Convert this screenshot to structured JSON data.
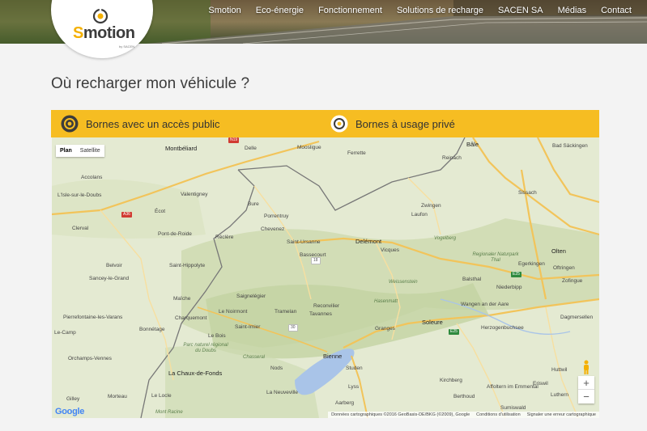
{
  "nav": [
    "Smotion",
    "Eco-énergie",
    "Fonctionnement",
    "Solutions de recharge",
    "SACEN SA",
    "Médias",
    "Contact"
  ],
  "logo": {
    "s": "S",
    "rest": "motion",
    "by": "by SACEN"
  },
  "page_title": "Où recharger mon véhicule ?",
  "tabs": {
    "public": "Bornes avec un accès public",
    "private": "Bornes à usage privé"
  },
  "map": {
    "type_plan": "Plan",
    "type_satellite": "Satellite",
    "zoom_in": "+",
    "zoom_out": "−",
    "google": "Google",
    "attribution": [
      "Données cartographiques ©2016 GeoBasis-DE/BKG (©2009), Google",
      "Conditions d'utilisation",
      "Signaler une erreur cartographique"
    ],
    "towns": [
      "Bâle",
      "Bad Säckingen",
      "Montbéliard",
      "Delle",
      "Moosligue",
      "Ferrette",
      "Reinach",
      "Accolans",
      "L'Isle-sur-le-Doubs",
      "Valentigney",
      "Sissach",
      "Écot",
      "Bure",
      "Porrentruy",
      "Zwingen",
      "Laufon",
      "Clerval",
      "Chevenez",
      "Pont-de-Roide",
      "Réclère",
      "Saint-Ursanne",
      "Delémont",
      "Vicques",
      "Olten",
      "Belvoir",
      "Saint-Hippolyte",
      "Bassecourt",
      "Egerkingen",
      "Oftringen",
      "Sancey-le-Grand",
      "Balsthal",
      "Niederbipp",
      "Zofingue",
      "Maîche",
      "Saignelégier",
      "Le Noirmont",
      "Tramelan",
      "Reconvilier",
      "Tavannes",
      "Wangen an der Aare",
      "Charquemont",
      "Pierrefontaine-les-Varans",
      "Bonnétage",
      "Le Bois",
      "Herzogenbuchsee",
      "Dagmersellen",
      "Le-Camp",
      "Saint-Imier",
      "Granges",
      "Soleure",
      "Orchamps-Vennes",
      "La Chaux-de-Fonds",
      "Bienne",
      "Nods",
      "Studen",
      "Lyss",
      "Kirchberg",
      "Berthoud",
      "Affoltern im Emmental",
      "Eriswil",
      "Gilley",
      "Morteau",
      "Le Locle",
      "La Neuveville",
      "Aarberg",
      "Luthern",
      "Sumiswald",
      "Huttwil"
    ],
    "regions": [
      "Vogelberg",
      "Regionaler Naturpark Thal",
      "Weissenstein",
      "Hasenmatt",
      "Chasseral",
      "Parc naturel régional du Doubs",
      "Mont Racine"
    ]
  }
}
